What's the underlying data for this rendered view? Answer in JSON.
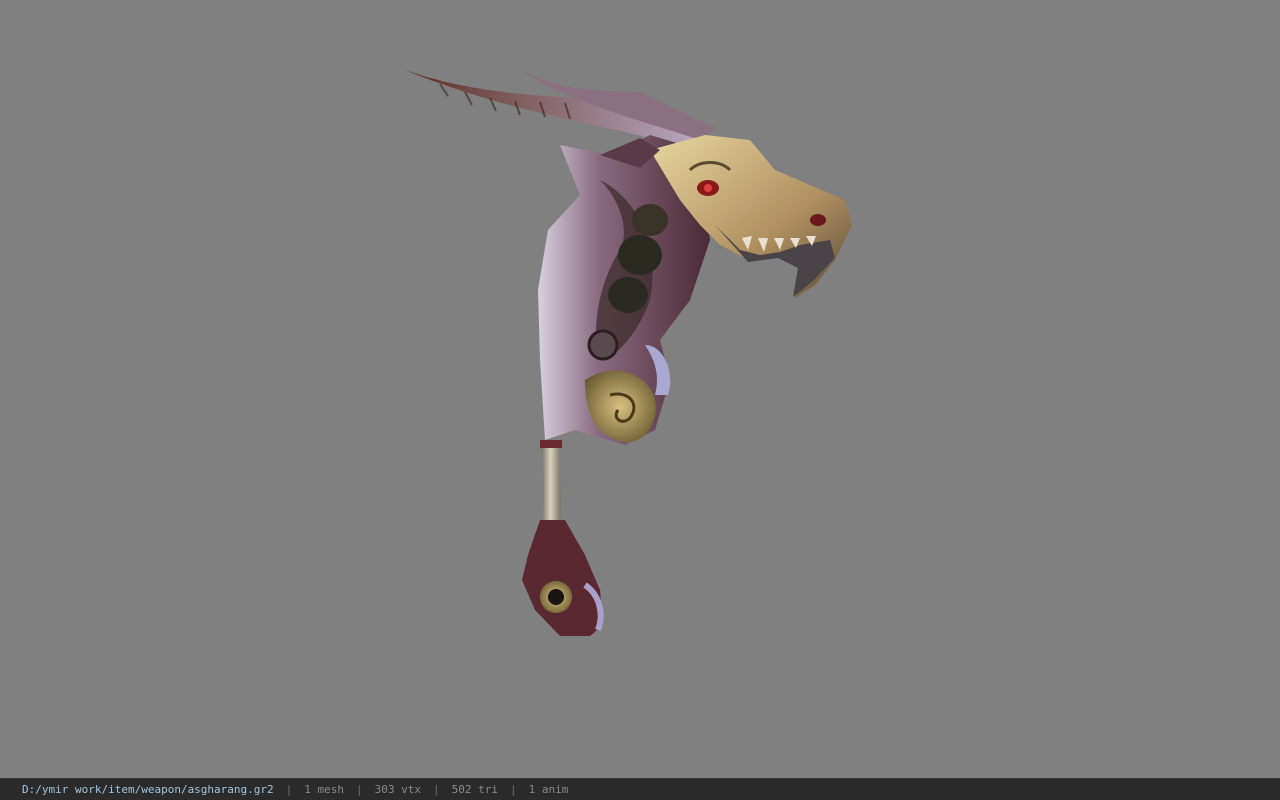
{
  "viewer": {
    "background_color": "#808080",
    "model_icon": "dragon-head-weapon-model"
  },
  "status_bar": {
    "file_path": "D:/ymir work/item/weapon/asgharang.gr2",
    "separator": "|",
    "mesh_count": "1 mesh",
    "vertex_count": "303 vtx",
    "triangle_count": "502 tri",
    "anim_count": "1 anim"
  }
}
